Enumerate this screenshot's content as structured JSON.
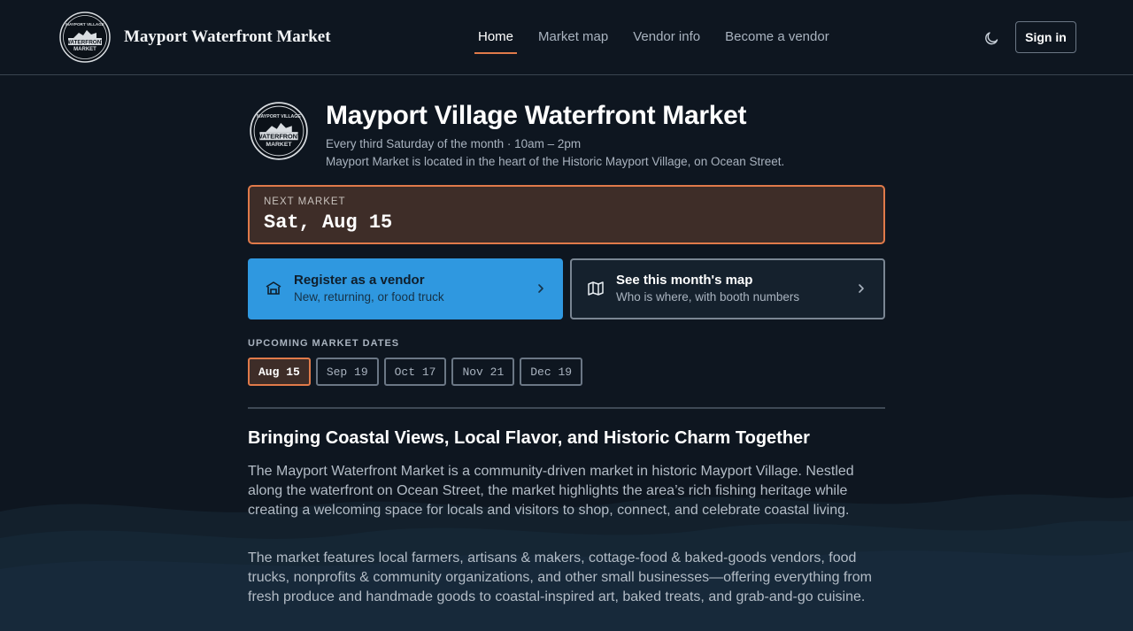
{
  "header": {
    "brand_name": "Mayport Waterfront Market",
    "logo_text": {
      "top": "MAYPORT VILLAGE",
      "mid1": "WATERFRONT",
      "mid2": "MARKET"
    },
    "nav": [
      "Home",
      "Market map",
      "Vendor info",
      "Become a vendor"
    ],
    "active_nav": "Home",
    "sign_in": "Sign in",
    "theme_icon": "moon-icon"
  },
  "hero": {
    "title": "Mayport Village Waterfront Market",
    "schedule": "Every third Saturday of the month · 10am – 2pm",
    "location": "Mayport Market is located in the heart of the Historic Mayport Village, on Ocean Street."
  },
  "next_market": {
    "label": "NEXT MARKET",
    "date": "Sat, Aug 15"
  },
  "cards": {
    "vendor": {
      "title": "Register as a vendor",
      "subtitle": "New, returning, or food truck",
      "icon": "storefront-icon"
    },
    "map": {
      "title": "See this month's map",
      "subtitle": "Who is where, with booth numbers",
      "icon": "map-icon"
    }
  },
  "upcoming": {
    "label": "UPCOMING MARKET DATES",
    "dates": [
      "Aug 15",
      "Sep 19",
      "Oct 17",
      "Nov 21",
      "Dec 19"
    ],
    "selected": "Aug 15"
  },
  "about": {
    "title": "Bringing Coastal Views, Local Flavor, and Historic Charm Together",
    "p1": "The Mayport Waterfront Market is a community-driven market in historic Mayport Village. Nestled along the waterfront on Ocean Street, the market highlights the area’s rich fishing heritage while creating a welcoming space for locals and visitors to shop, connect, and celebrate coastal living.",
    "p2": "The market features local farmers, artisans & makers, cottage-food & baked-goods vendors, food trucks, nonprofits & community organizations, and other small businesses—offering everything from fresh produce and handmade goods to coastal-inspired art, baked treats, and grab-and-go cuisine."
  },
  "colors": {
    "background": "#0e1620",
    "accent": "#e07a4a",
    "primary_button": "#2f98e0"
  }
}
